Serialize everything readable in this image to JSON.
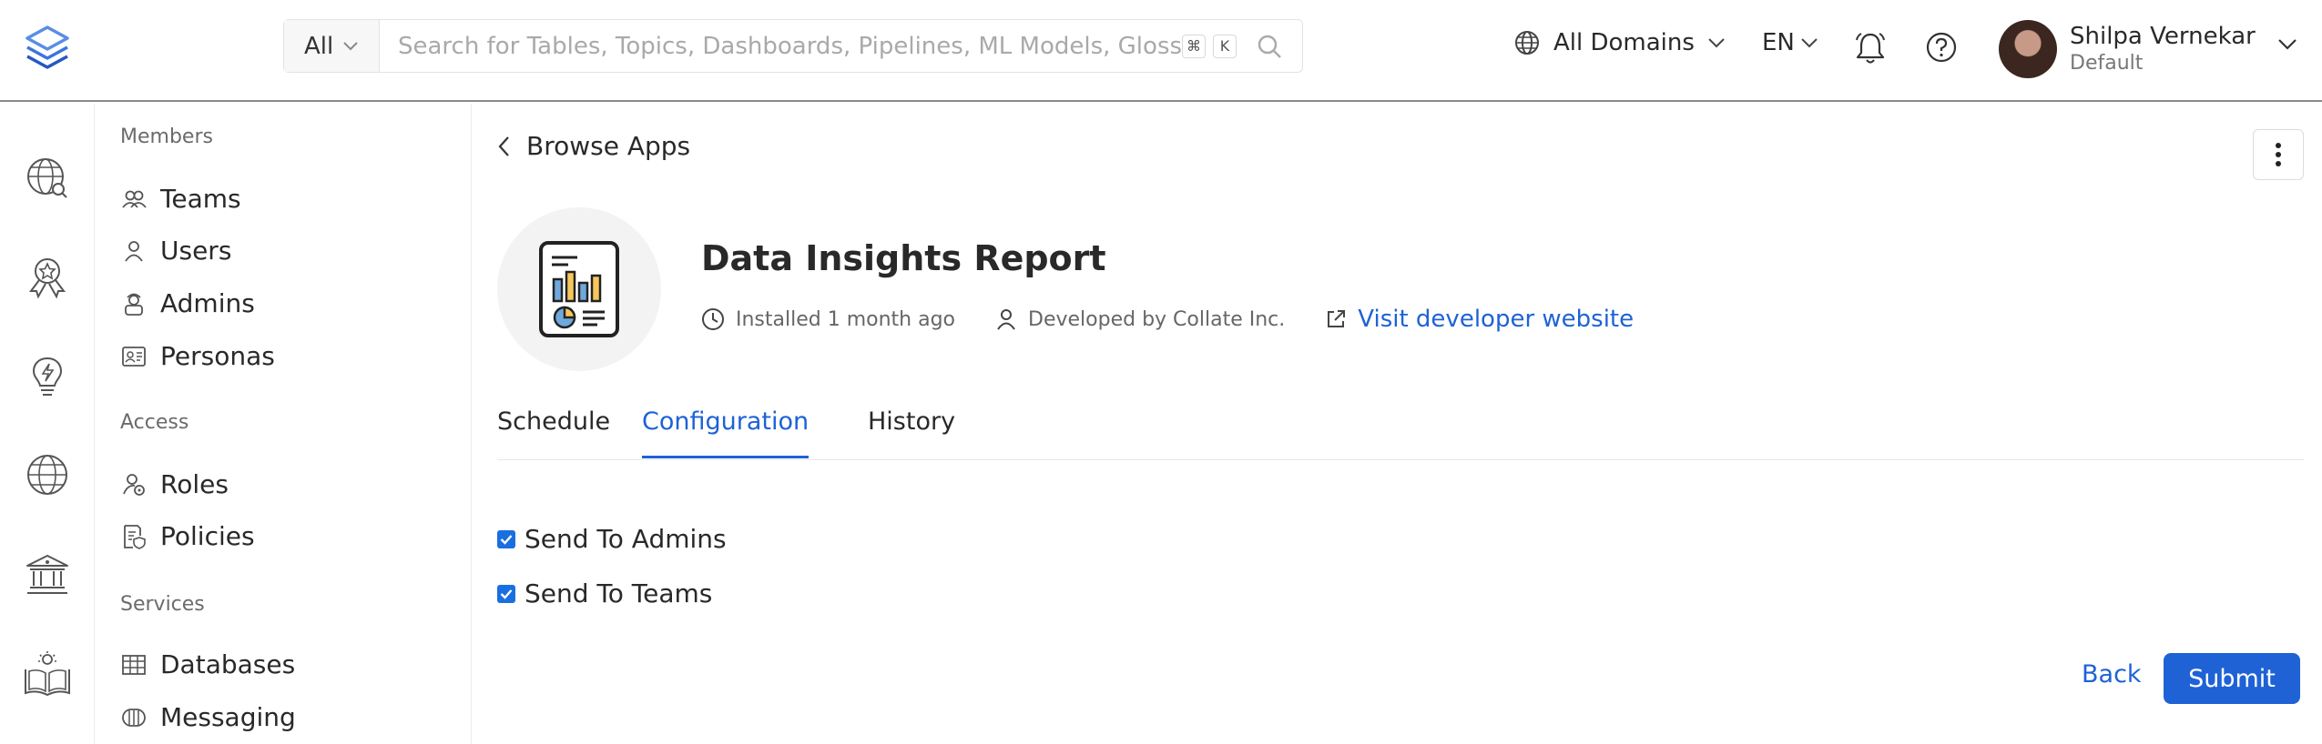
{
  "header": {
    "search_scope": "All",
    "search_placeholder": "Search for Tables, Topics, Dashboards, Pipelines, ML Models, Gloss...",
    "kbd_cmd": "⌘",
    "kbd_k": "K",
    "domains_label": "All Domains",
    "language": "EN",
    "user_name": "Shilpa Vernekar",
    "user_role": "Default"
  },
  "rail": {
    "icons": [
      "explore-icon",
      "quality-icon",
      "insights-icon",
      "domains-icon",
      "governance-icon",
      "settings-icon"
    ]
  },
  "subnav": {
    "groups": {
      "members": "Members",
      "access": "Access",
      "services": "Services"
    },
    "items": {
      "teams": "Teams",
      "users": "Users",
      "admins": "Admins",
      "personas": "Personas",
      "roles": "Roles",
      "policies": "Policies",
      "databases": "Databases",
      "messaging": "Messaging"
    }
  },
  "main": {
    "back_label": "Browse Apps",
    "app_title": "Data Insights Report",
    "installed": "Installed 1 month ago",
    "developer": "Developed by Collate Inc.",
    "website_link": "Visit developer website",
    "tabs": [
      "Schedule",
      "Configuration",
      "History"
    ],
    "active_tab": "Configuration",
    "options": [
      {
        "label": "Send To Admins",
        "checked": true
      },
      {
        "label": "Send To Teams",
        "checked": true
      }
    ],
    "back_button": "Back",
    "submit_button": "Submit"
  },
  "colors": {
    "accent": "#1e62d6",
    "checkbox": "#1a6fe0"
  }
}
